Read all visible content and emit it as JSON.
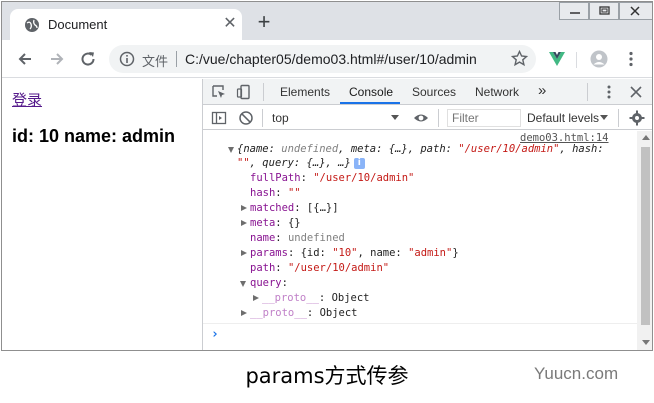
{
  "tab": {
    "title": "Document"
  },
  "address": {
    "scheme_label": "文件",
    "url": "C:/vue/chapter05/demo03.html#/user/10/admin"
  },
  "page": {
    "login_link": "登录",
    "heading": "id: 10 name: admin"
  },
  "devtools": {
    "tabs": [
      "Elements",
      "Console",
      "Sources",
      "Network"
    ],
    "active_tab": "Console",
    "more_tabs": "»",
    "context": "top",
    "filter_placeholder": "Filter",
    "levels": "Default levels"
  },
  "console": {
    "source": "demo03.html:14",
    "summary_line1_parts": [
      "{name: ",
      "undefined",
      ", meta: {…}, path: ",
      "\"/user/10/admin\"",
      ", hash:"
    ],
    "summary_line2_parts": [
      "\"\"",
      ", query: {…}, …}"
    ],
    "info_badge": "i",
    "props": [
      {
        "key": "fullPath",
        "value": "\"/user/10/admin\"",
        "kind": "str",
        "expandable": false
      },
      {
        "key": "hash",
        "value": "\"\"",
        "kind": "str",
        "expandable": false
      },
      {
        "key": "matched",
        "value": "[{…}]",
        "kind": "obj",
        "expandable": true
      },
      {
        "key": "meta",
        "value": "{}",
        "kind": "obj",
        "expandable": true
      },
      {
        "key": "name",
        "value": "undefined",
        "kind": "undef",
        "expandable": false
      },
      {
        "key": "params",
        "value_parts": [
          "{id: ",
          "\"10\"",
          ", name: ",
          "\"admin\"",
          "}"
        ],
        "kind": "mixed",
        "expandable": true
      },
      {
        "key": "path",
        "value": "\"/user/10/admin\"",
        "kind": "str",
        "expandable": false
      },
      {
        "key": "query",
        "value": "",
        "kind": "obj",
        "expandable": true,
        "expanded": true
      },
      {
        "key": "__proto__",
        "value": "Object",
        "kind": "proto",
        "expandable": true,
        "nested": true
      },
      {
        "key": "__proto__",
        "value": "Object",
        "kind": "proto",
        "expandable": true
      }
    ],
    "prompt": "›"
  },
  "caption": "params方式传参",
  "watermark": "Yuucn.com",
  "colors": {
    "accent": "#1a73e8",
    "key": "#881391",
    "string": "#c41a16",
    "link": "#551a8b"
  }
}
